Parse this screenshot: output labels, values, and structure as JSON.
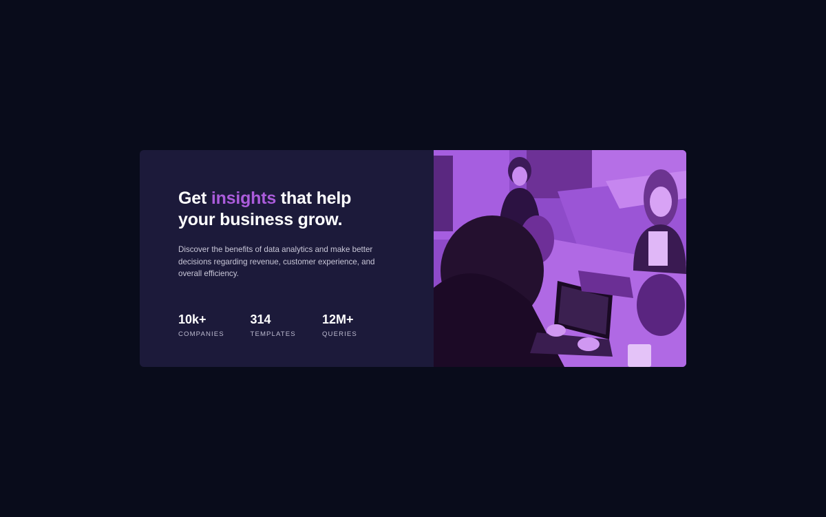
{
  "hero": {
    "headline_before": "Get ",
    "headline_accent": "insights",
    "headline_after": " that help your business grow.",
    "description": "Discover the benefits of data analytics and make better decisions regarding revenue, customer experience, and overall efficiency."
  },
  "stats": [
    {
      "value": "10k+",
      "label": "COMPANIES"
    },
    {
      "value": "314",
      "label": "TEMPLATES"
    },
    {
      "value": "12M+",
      "label": "QUERIES"
    }
  ],
  "image": {
    "subject": "people working at a table with laptops, purple overlay"
  },
  "colors": {
    "page_background": "#090c1b",
    "card_background": "#1c1a3a",
    "accent": "#ab5cdb",
    "image_overlay": "#aa5cdb"
  }
}
